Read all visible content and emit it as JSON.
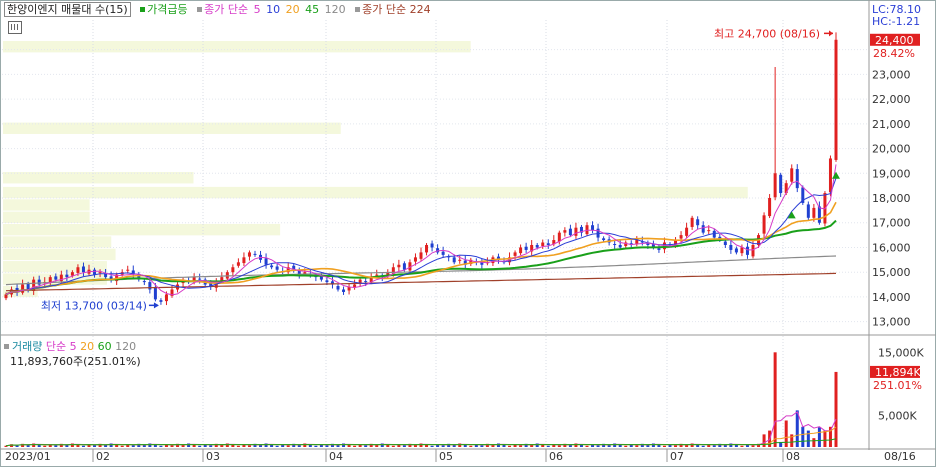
{
  "legend": {
    "stock": "한양이엔지 매물대 수(15)",
    "spike": "가격급등",
    "ma_label": "종가 단순",
    "ma_periods": [
      "5",
      "10",
      "20",
      "45",
      "120"
    ],
    "ma_colors": [
      "#d63cc8",
      "#2b3fd6",
      "#f0a020",
      "#1aa01a",
      "#8a8a8a"
    ],
    "long_label": "종가 단순 224",
    "long_color": "#a0402a"
  },
  "right_info": {
    "lc": "LC:78.10",
    "hc": "HC:-1.21"
  },
  "volume_legend": {
    "label": "거래량",
    "ma_label": "단순",
    "periods": [
      "5",
      "20",
      "60",
      "120"
    ],
    "colors": [
      "#d63cc8",
      "#f0a020",
      "#1aa01a",
      "#8a8a8a"
    ],
    "current": "11,893,760주(251.01%)"
  },
  "annotations": {
    "high": "최고 24,700 (08/16)",
    "low": "최저 13,700 (03/14)"
  },
  "current_price": {
    "value": "24,400",
    "pct": "28.42%"
  },
  "current_volume": {
    "value": "11,894K",
    "pct": "251.01%"
  },
  "colors": {
    "up": "#e02020",
    "down": "#2040d0",
    "volume_profile": "#f4f8dc",
    "tag_red": "#e02020"
  },
  "chart_data": {
    "type": "candlestick",
    "x_labels": [
      "2023/01",
      "02",
      "03",
      "04",
      "05",
      "06",
      "07",
      "08",
      "08/16"
    ],
    "price_axis": {
      "ticks": [
        13000,
        14000,
        15000,
        16000,
        17000,
        18000,
        19000,
        20000,
        21000,
        22000,
        23000,
        24000
      ],
      "labels": [
        "13,000",
        "14,000",
        "15,000",
        "16,000",
        "17,000",
        "18,000",
        "19,000",
        "20,000",
        "21,000",
        "22,000",
        "23,000"
      ],
      "range": [
        12500,
        25200
      ]
    },
    "volume_axis": {
      "ticks": [
        5000,
        15000
      ],
      "labels": [
        "5,000K",
        "15,000K"
      ],
      "range": [
        0,
        16000
      ]
    },
    "volume_profile": [
      {
        "price": 14200,
        "w": 0.04
      },
      {
        "price": 14700,
        "w": 0.12
      },
      {
        "price": 15200,
        "w": 0.12
      },
      {
        "price": 15700,
        "w": 0.13
      },
      {
        "price": 16200,
        "w": 0.125
      },
      {
        "price": 16700,
        "w": 0.32
      },
      {
        "price": 17200,
        "w": 0.1
      },
      {
        "price": 17700,
        "w": 0.1
      },
      {
        "price": 18200,
        "w": 0.86
      },
      {
        "price": 18800,
        "w": 0.22
      },
      {
        "price": 20800,
        "w": 0.39
      },
      {
        "price": 24100,
        "w": 0.54
      }
    ],
    "candles": {
      "description_free": true,
      "close_path": [
        14100,
        14300,
        14200,
        14500,
        14300,
        14700,
        14500,
        14600,
        14800,
        14700,
        14900,
        14800,
        15000,
        15200,
        15000,
        15100,
        14900,
        15000,
        14800,
        14700,
        14900,
        15000,
        15100,
        14900,
        14700,
        14600,
        14300,
        13900,
        13800,
        14100,
        14300,
        14500,
        14700,
        14600,
        14800,
        14700,
        14500,
        14400,
        14600,
        14800,
        15000,
        15200,
        15400,
        15600,
        15800,
        15700,
        15500,
        15300,
        15200,
        15100,
        15000,
        15200,
        15100,
        14900,
        15000,
        14900,
        14800,
        14700,
        14600,
        14500,
        14300,
        14200,
        14400,
        14500,
        14700,
        14600,
        14800,
        14900,
        14800,
        15000,
        15200,
        15300,
        15100,
        15400,
        15600,
        15800,
        16100,
        16000,
        15800,
        15700,
        15600,
        15400,
        15500,
        15300,
        15500,
        15400,
        15300,
        15400,
        15600,
        15500,
        15400,
        15600,
        15800,
        16000,
        15900,
        16100,
        16000,
        16200,
        16100,
        16300,
        16600,
        16700,
        16500,
        16800,
        16600,
        16900,
        16700,
        16400,
        16300,
        16200,
        16100,
        16000,
        16200,
        16100,
        16300,
        16200,
        16100,
        16000,
        15900,
        16200,
        16100,
        16300,
        16500,
        16800,
        17200,
        16900,
        16600,
        16700,
        16400,
        16300,
        16100,
        15900,
        15800,
        16000,
        15700,
        16100,
        16500,
        17300,
        18000,
        19000,
        18200,
        18600,
        19200,
        18400,
        17800,
        17200,
        17600,
        17000,
        18200,
        19600,
        24400
      ],
      "high_points": [
        {
          "idx": 150,
          "value": 24700
        },
        {
          "idx": 139,
          "value": 23300
        }
      ]
    },
    "moving_averages": {
      "ma5": {
        "color": "#d63cc8"
      },
      "ma10": {
        "color": "#2b3fd6"
      },
      "ma20": {
        "color": "#f0a020"
      },
      "ma45": {
        "color": "#1aa01a"
      },
      "ma120": {
        "color": "#8a8a8a"
      },
      "ma224": {
        "color": "#a0402a"
      }
    }
  }
}
